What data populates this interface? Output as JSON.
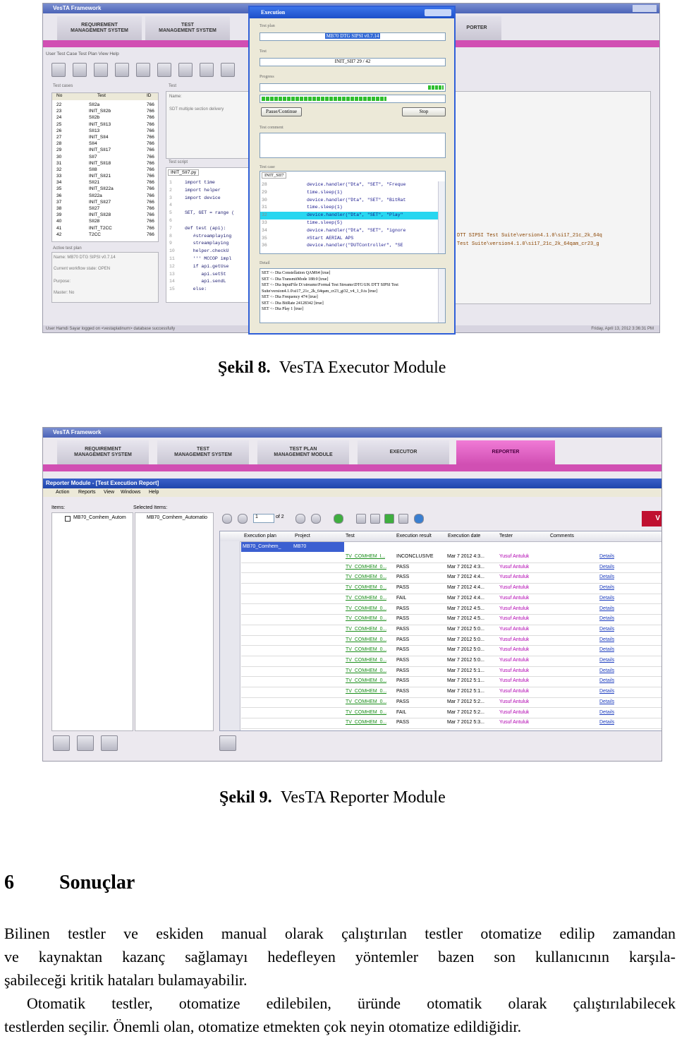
{
  "figure8": {
    "caption_label": "Şekil 8.",
    "caption_text": "VesTA Executor Module",
    "window_title": "VesTA Framework",
    "tabs": [
      "REQUIREMENT\nMANAGEMENT SYSTEM",
      "TEST\nMANAGEMENT SYSTEM",
      "PORTER"
    ],
    "menu": "User   Test Case   Test Plan   View   Help",
    "test_cases_label": "Test cases",
    "test_label": "Test",
    "test_cases_headers": [
      "No",
      "Test",
      "ID"
    ],
    "test_cases": [
      [
        "22",
        "SII2a",
        "766"
      ],
      [
        "23",
        "INIT_SII2b",
        "766"
      ],
      [
        "24",
        "SII2b",
        "766"
      ],
      [
        "25",
        "INIT_SII13",
        "766"
      ],
      [
        "26",
        "SII13",
        "766"
      ],
      [
        "27",
        "INIT_SII4",
        "766"
      ],
      [
        "28",
        "SII4",
        "766"
      ],
      [
        "29",
        "INIT_SII17",
        "766"
      ],
      [
        "30",
        "SII7",
        "766"
      ],
      [
        "31",
        "INIT_SII18",
        "766"
      ],
      [
        "32",
        "SII8",
        "766"
      ],
      [
        "33",
        "INIT_SII21",
        "766"
      ],
      [
        "34",
        "SII21",
        "766"
      ],
      [
        "35",
        "INIT_SII22a",
        "766"
      ],
      [
        "36",
        "SII22a",
        "766"
      ],
      [
        "37",
        "INIT_SII27",
        "766"
      ],
      [
        "38",
        "SII27",
        "766"
      ],
      [
        "39",
        "INIT_SII28",
        "766"
      ],
      [
        "40",
        "SII28",
        "766"
      ],
      [
        "41",
        "INIT_T2CC",
        "766"
      ],
      [
        "42",
        "T2CC",
        "766"
      ]
    ],
    "name_label": "Name:",
    "sdt_text": "SDT multiple section delivery",
    "test_script_label": "Test script",
    "script_tab": "INIT_SII7.py",
    "script_lines": [
      "import time",
      "import helper",
      "import device",
      "",
      "SET, GET = range (",
      "",
      "def test (api):",
      "   #streamplaying",
      "   streamplaying",
      "   helper.checkU",
      "   ''' MCCOP impl",
      "   if api.getUse",
      "      api.setSt",
      "      api.sendL",
      "   else:"
    ],
    "active_test_plan_label": "Active test plan",
    "plan_name": "Name: MB70 DTG SIPSI v0.7.14",
    "workflow_state": "Current workflow state: OPEN",
    "purpose": "Purpose:",
    "master": "Master: No",
    "right_console": [
      "DTT SIPSI Test Suite\\version4.1.0\\si17_21c_2k_64q",
      "Test Suite\\version4.1.0\\si17_21c_2k_64qam_cr23_g"
    ],
    "status_left": "User Hamdi Sayar logged on <vestaplatinum> database successfully",
    "status_right": "Friday, April 13, 2012     3:36:31 PM",
    "executor": {
      "title": "Execution",
      "test_plan_label": "Test plan",
      "test_plan_value": "MB70 DTG SIPSI v0.7.14",
      "test_label": "Test",
      "test_value": "INIT_SII7    29 / 42",
      "progress_label": "Progress",
      "pause_button": "Pause/Continue",
      "stop_button": "Stop",
      "comment_label": "Test comment",
      "case_label": "Test case",
      "case_tab": "INIT_SII7",
      "code_lines": [
        [
          "28",
          "device.handler(\"Dta\", \"SET\", \"Freque"
        ],
        [
          "29",
          "time.sleep(1)"
        ],
        [
          "30",
          "device.handler(\"Dta\", \"SET\", \"BitRat"
        ],
        [
          "31",
          "time.sleep(1)"
        ],
        [
          "32",
          "device.handler(\"Dta\", \"SET\", \"Play\""
        ],
        [
          "33",
          "time.sleep(5)"
        ],
        [
          "34",
          "device.handler(\"Dta\", \"SET\", \"ignore"
        ],
        [
          "35",
          "#Start AERIAL APS"
        ],
        [
          "36",
          "device.handler(\"DUTController\", \"SE"
        ]
      ],
      "detail_label": "Detail",
      "detail_lines": [
        "SET <- Dta Constellation QAM64 [true]",
        "SET <- Dta TransmitMode 188:0 [true]",
        "SET <- Dta InputFile D:\\streams\\Formal Test Streams\\DTG\\UK DTT SIPSI Test",
        "Suite\\version4.1.0\\si17_21c_2k_64qam_cr23_gi32_v4_1_0.ts [true]",
        "SET <- Dta Frequency 474 [true]",
        "SET <- Dta BitRate 24128342 [true]",
        "SET <- Dta Play 1 [true]"
      ]
    }
  },
  "figure9": {
    "caption_label": "Şekil 9.",
    "caption_text": "VesTA Reporter Module",
    "window_title": "VesTA Framework",
    "tabs": [
      "REQUIREMENT\nMANAGEMENT SYSTEM",
      "TEST\nMANAGEMENT SYSTEM",
      "TEST PLAN\nMANAGEMENT MODULE",
      "EXECUTOR",
      "REPORTER"
    ],
    "module_title": "Reporter Module - [Test Execution Report]",
    "menu": [
      "Action",
      "Reports",
      "View",
      "Windows",
      "Help"
    ],
    "items_label": "Items:",
    "selected_items_label": "Selected Items:",
    "item_tree": "MB70_Comhem_Autom",
    "selected_item": "MB70_Comhem_Automatio",
    "page_value": "1",
    "page_of": "of 2",
    "headers": [
      "Execution plan",
      "Project",
      "Test",
      "Execution result",
      "Execution date",
      "Tester",
      "Comments"
    ],
    "first_row": {
      "plan": "MB70_Comhem_",
      "project": "MB70"
    },
    "rows": [
      [
        "TV_COMHEM_I...",
        "INCONCLUSIVE",
        "Mar 7 2012 4:3...",
        "Yusuf Antuluk",
        "Details"
      ],
      [
        "TV_COMHEM_0...",
        "PASS",
        "Mar 7 2012 4:3...",
        "Yusuf Antuluk",
        "Details"
      ],
      [
        "TV_COMHEM_0...",
        "PASS",
        "Mar 7 2012 4:4...",
        "Yusuf Antuluk",
        "Details"
      ],
      [
        "TV_COMHEM_0...",
        "PASS",
        "Mar 7 2012 4:4...",
        "Yusuf Antuluk",
        "Details"
      ],
      [
        "TV_COMHEM_0...",
        "FAIL",
        "Mar 7 2012 4:4...",
        "Yusuf Antuluk",
        "Details"
      ],
      [
        "TV_COMHEM_0...",
        "PASS",
        "Mar 7 2012 4:5...",
        "Yusuf Antuluk",
        "Details"
      ],
      [
        "TV_COMHEM_0...",
        "PASS",
        "Mar 7 2012 4:5...",
        "Yusuf Antuluk",
        "Details"
      ],
      [
        "TV_COMHEM_0...",
        "PASS",
        "Mar 7 2012 5:0...",
        "Yusuf Antuluk",
        "Details"
      ],
      [
        "TV_COMHEM_0...",
        "PASS",
        "Mar 7 2012 5:0...",
        "Yusuf Antuluk",
        "Details"
      ],
      [
        "TV_COMHEM_0...",
        "PASS",
        "Mar 7 2012 5:0...",
        "Yusuf Antuluk",
        "Details"
      ],
      [
        "TV_COMHEM_0...",
        "PASS",
        "Mar 7 2012 5:0...",
        "Yusuf Antuluk",
        "Details"
      ],
      [
        "TV_COMHEM_0...",
        "PASS",
        "Mar 7 2012 5:1...",
        "Yusuf Antuluk",
        "Details"
      ],
      [
        "TV_COMHEM_0...",
        "PASS",
        "Mar 7 2012 5:1...",
        "Yusuf Antuluk",
        "Details"
      ],
      [
        "TV_COMHEM_0...",
        "PASS",
        "Mar 7 2012 5:1...",
        "Yusuf Antuluk",
        "Details"
      ],
      [
        "TV_COMHEM_0...",
        "PASS",
        "Mar 7 2012 5:2...",
        "Yusuf Antuluk",
        "Details"
      ],
      [
        "TV_COMHEM_0...",
        "FAIL",
        "Mar 7 2012 5:2...",
        "Yusuf Antuluk",
        "Details"
      ],
      [
        "TV_COMHEM_0...",
        "PASS",
        "Mar 7 2012 5:3...",
        "Yusuf Antuluk",
        "Details"
      ]
    ],
    "brand_mark": "V"
  },
  "section": {
    "number": "6",
    "title": "Sonuçlar"
  },
  "paragraphs": {
    "p1_line1": "Bilinen testler ve eskiden manual olarak çalıştırılan testler otomatize edilip zamandan",
    "p1_line2": "ve kaynaktan kazanç sağlamayı hedefleyen yöntemler bazen son kullanıcının karşıla-",
    "p1_line3": "şabileceği kritik hataları bulamayabilir.",
    "p2_line1": "Otomatik testler, otomatize edilebilen, üründe otomatik olarak çalıştırılabilecek",
    "p2_line2": "testlerden seçilir. Önemli olan, otomatize etmekten çok neyin otomatize edildiğidir."
  },
  "colors": {
    "accent_pink": "#d14fb3",
    "title_blue": "#2f5fd8",
    "pass_green": "#1b8e1b",
    "tester_purple": "#b000b0",
    "link_blue": "#1f3fbf",
    "highlight_cyan": "#27d6f0"
  }
}
